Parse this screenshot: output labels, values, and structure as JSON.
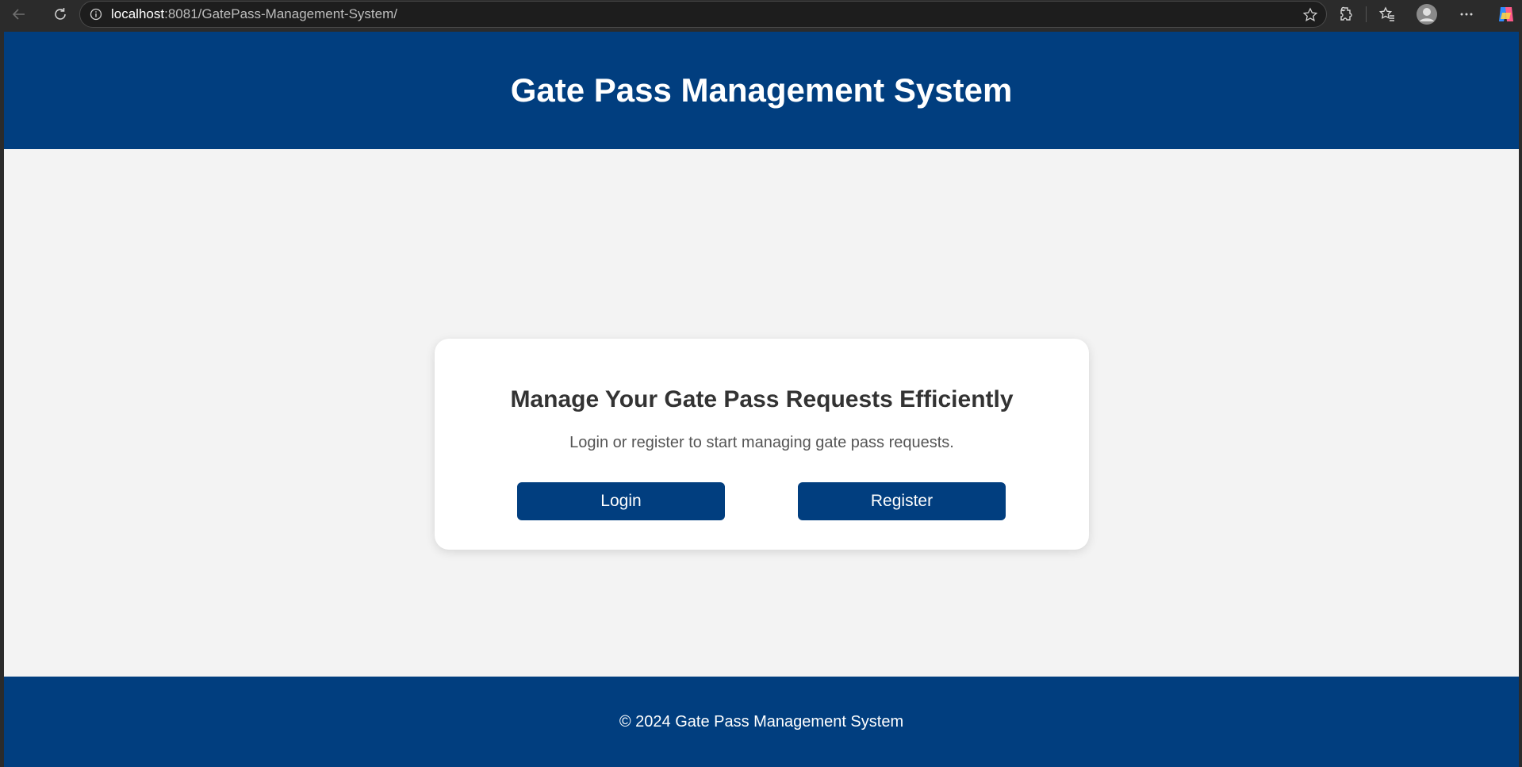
{
  "browser": {
    "url_host": "localhost",
    "url_rest": ":8081/GatePass-Management-System/"
  },
  "header": {
    "title": "Gate Pass Management System"
  },
  "card": {
    "heading": "Manage Your Gate Pass Requests Efficiently",
    "subtitle": "Login or register to start managing gate pass requests.",
    "login_label": "Login",
    "register_label": "Register"
  },
  "footer": {
    "text": "© 2024 Gate Pass Management System"
  },
  "colors": {
    "brand": "#013e7f",
    "page_bg": "#f3f3f3",
    "card_bg": "#ffffff"
  },
  "icons": [
    "back-arrow-icon",
    "reload-icon",
    "info-icon",
    "star-icon",
    "extensions-icon",
    "favorites-icon",
    "profile-avatar-icon",
    "more-options-icon",
    "copilot-icon"
  ]
}
